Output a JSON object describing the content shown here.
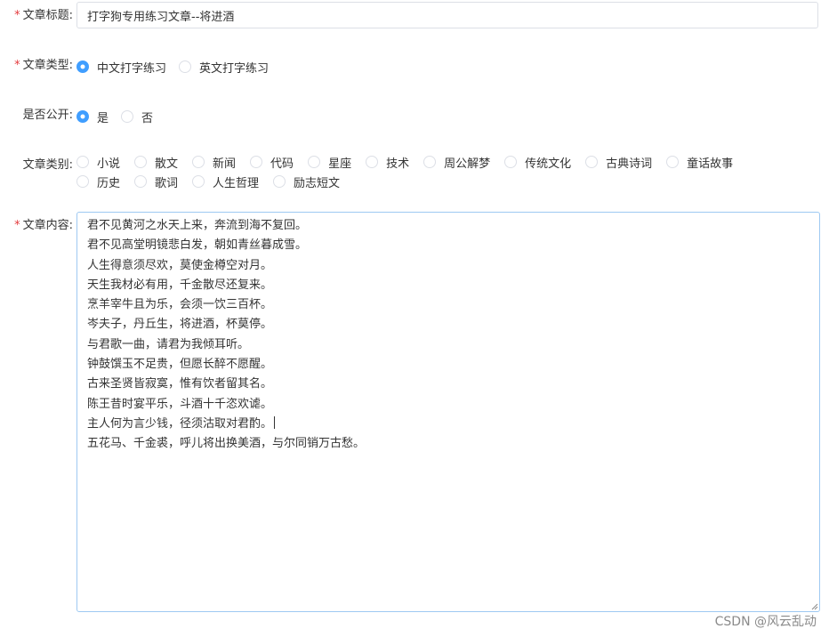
{
  "form": {
    "title": {
      "label": "文章标题:",
      "value": "打字狗专用练习文章--将进酒"
    },
    "type": {
      "label": "文章类型:",
      "options": [
        {
          "label": "中文打字练习",
          "checked": true
        },
        {
          "label": "英文打字练习",
          "checked": false
        }
      ]
    },
    "public": {
      "label": "是否公开:",
      "options": [
        {
          "label": "是",
          "checked": true
        },
        {
          "label": "否",
          "checked": false
        }
      ]
    },
    "category": {
      "label": "文章类别:",
      "options": [
        {
          "label": "小说",
          "checked": false
        },
        {
          "label": "散文",
          "checked": false
        },
        {
          "label": "新闻",
          "checked": false
        },
        {
          "label": "代码",
          "checked": false
        },
        {
          "label": "星座",
          "checked": false
        },
        {
          "label": "技术",
          "checked": false
        },
        {
          "label": "周公解梦",
          "checked": false
        },
        {
          "label": "传统文化",
          "checked": false
        },
        {
          "label": "古典诗词",
          "checked": false
        },
        {
          "label": "童话故事",
          "checked": false
        },
        {
          "label": "历史",
          "checked": false
        },
        {
          "label": "歌词",
          "checked": false
        },
        {
          "label": "人生哲理",
          "checked": false
        },
        {
          "label": "励志短文",
          "checked": false
        }
      ]
    },
    "content": {
      "label": "文章内容:",
      "lines": [
        "君不见黄河之水天上来，奔流到海不复回。",
        "君不见高堂明镜悲白发，朝如青丝暮成雪。",
        "人生得意须尽欢，莫使金樽空对月。",
        "天生我材必有用，千金散尽还复来。",
        "烹羊宰牛且为乐，会须一饮三百杯。",
        "岑夫子，丹丘生，将进酒，杯莫停。",
        "与君歌一曲，请君为我倾耳听。",
        "钟鼓馔玉不足贵，但愿长醉不愿醒。",
        "古来圣贤皆寂寞，惟有饮者留其名。",
        "陈王昔时宴平乐，斗酒十千恣欢谑。",
        "主人何为言少钱，径须沽取对君酌。",
        "五花马、千金裘，呼儿将出换美酒，与尔同销万古愁。"
      ]
    }
  },
  "watermark": "CSDN @风云乱动",
  "colors": {
    "accent": "#409eff",
    "required": "#e4393c",
    "border": "#dcdfe6",
    "focus_border": "#9ec9f2"
  }
}
